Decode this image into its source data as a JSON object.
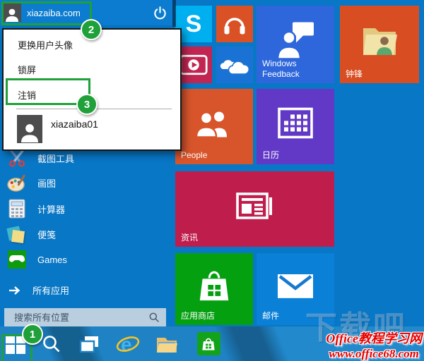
{
  "header": {
    "username": "xiazaiba.com"
  },
  "popup": {
    "items": [
      {
        "label": "更换用户头像"
      },
      {
        "label": "锁屏"
      },
      {
        "label": "注销"
      }
    ],
    "account": {
      "name": "xiazaiba01"
    }
  },
  "app_list": [
    {
      "label": "截图工具"
    },
    {
      "label": "画图"
    },
    {
      "label": "计算器"
    },
    {
      "label": "便笺"
    },
    {
      "label": "Games"
    }
  ],
  "all_apps": {
    "label": "所有应用"
  },
  "search": {
    "placeholder": "搜索所有位置"
  },
  "tiles": [
    {
      "name": "skype",
      "label": "",
      "letter": "S",
      "color": "#00aff0"
    },
    {
      "name": "music",
      "label": "",
      "color": "#d95125"
    },
    {
      "name": "windows-feedback",
      "label": "Windows Feedback",
      "color": "#2e66db"
    },
    {
      "name": "user-folder",
      "label": "钟锋",
      "color": "#d84e22"
    },
    {
      "name": "video",
      "label": "",
      "color": "#c12552"
    },
    {
      "name": "onedrive",
      "label": "",
      "color": "#1a73d4"
    },
    {
      "name": "people",
      "label": "People",
      "color": "#d8552c"
    },
    {
      "name": "calendar",
      "label": "日历",
      "color": "#6239c6"
    },
    {
      "name": "news",
      "label": "资讯",
      "color": "#bf1e4c"
    },
    {
      "name": "store",
      "label": "应用商店",
      "color": "#05a00f"
    },
    {
      "name": "mail",
      "label": "邮件",
      "color": "#0b80d7"
    }
  ],
  "annotations": {
    "step1": "1",
    "step2": "2",
    "step3": "3",
    "color": "#1fa039"
  },
  "watermarks": {
    "big": "下载吧",
    "line1": "Office教程学习网",
    "line2": "www.office68.com"
  },
  "colors": {
    "menu_bg": "#0877c6",
    "taskbar": "#1e82c4",
    "search_box": "#b9cede",
    "watermark_red": "#e60000"
  }
}
